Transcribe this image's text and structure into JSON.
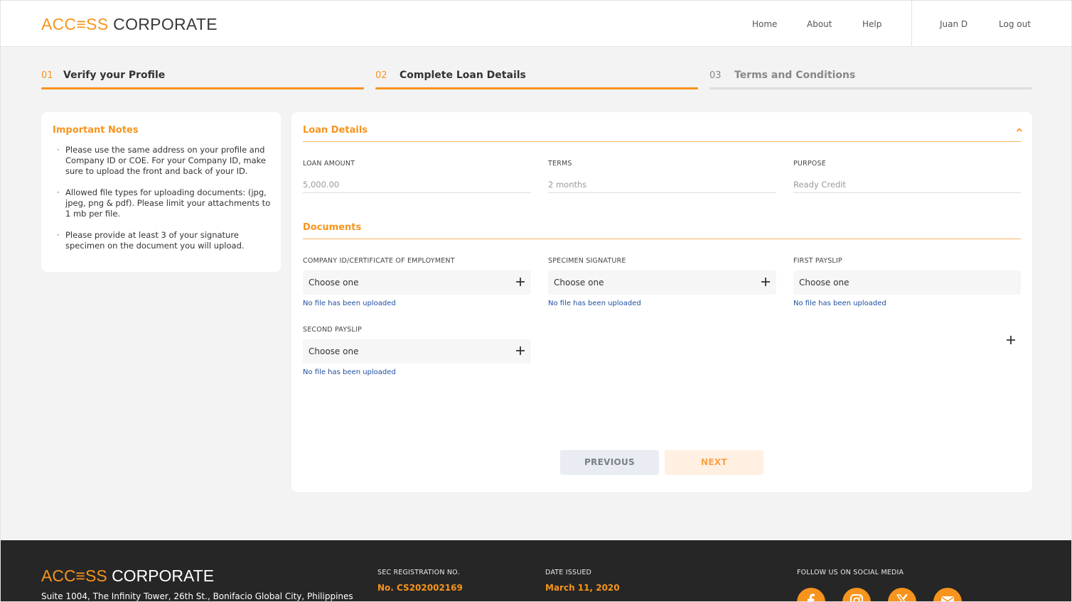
{
  "brand": {
    "part1": "ACC≡SS",
    "part2": "CORPORATE",
    "accent_color": "#f7941d"
  },
  "nav": {
    "home": "Home",
    "about": "About",
    "help": "Help",
    "user": "Juan D",
    "logout": "Log out"
  },
  "stepper": [
    {
      "num": "01",
      "label": "Verify your Profile",
      "state": "complete"
    },
    {
      "num": "02",
      "label": "Complete Loan Details",
      "state": "active"
    },
    {
      "num": "03",
      "label": "Terms and Conditions",
      "state": "pending"
    }
  ],
  "notes": {
    "title": "Important Notes",
    "items": [
      "Please use the same address on your profile and Company ID or COE. For your Company ID, make sure to upload the front and back of your ID.",
      "Allowed file types for uploading documents: (jpg, jpeg, png & pdf). Please limit your attachments to 1 mb per file.",
      "Please provide at least 3 of your signature specimen on the document you will upload."
    ]
  },
  "loan": {
    "title": "Loan Details",
    "fields": [
      {
        "label": "LOAN AMOUNT",
        "value": "5,000.00"
      },
      {
        "label": "TERMS",
        "value": "2 months"
      },
      {
        "label": "PURPOSE",
        "value": "Ready Credit"
      }
    ]
  },
  "documents": {
    "title": "Documents",
    "items": [
      {
        "label": "COMPANY ID/CERTIFICATE OF EMPLOYMENT",
        "select": "Choose one",
        "status": "No file has been uploaded"
      },
      {
        "label": "SPECIMEN SIGNATURE",
        "select": "Choose one",
        "status": "No file has been uploaded"
      },
      {
        "label": "FIRST PAYSLIP",
        "select": "Choose one",
        "status": "No file has been uploaded"
      },
      {
        "label": "SECOND PAYSLIP",
        "select": "Choose one",
        "status": "No file has been uploaded"
      }
    ]
  },
  "buttons": {
    "previous": "PREVIOUS",
    "next": "NEXT"
  },
  "footer": {
    "address": "Suite 1004, The Infinity Tower, 26th St., Bonifacio Global City, Philippines",
    "sec_label": "SEC REGISTRATION NO.",
    "sec_value": "No. CS202002169",
    "date_label": "DATE ISSUED",
    "date_value": "March 11, 2020",
    "social_label": "FOLLOW US ON SOCIAL MEDIA",
    "social_icons": [
      "facebook-icon",
      "instagram-icon",
      "x-icon",
      "email-icon"
    ]
  }
}
